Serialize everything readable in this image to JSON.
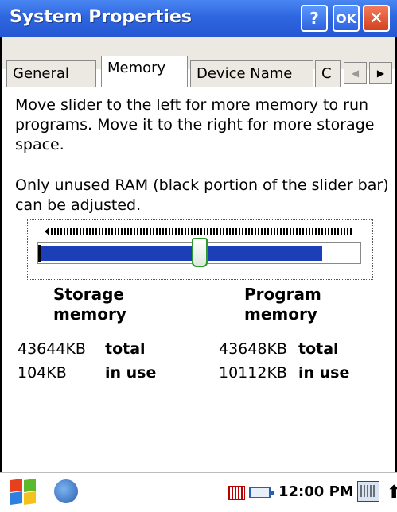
{
  "window": {
    "title": "System Properties",
    "help_label": "?",
    "ok_label": "OK",
    "close_label": "✕"
  },
  "tabs": [
    {
      "label": "General"
    },
    {
      "label": "Memory"
    },
    {
      "label": "Device Name"
    },
    {
      "label": "C"
    }
  ],
  "tab_scroll": {
    "left": "◀",
    "right": "▶"
  },
  "instructions": {
    "line1": "Move slider to the left for more memory to run programs. Move it to the right for more storage space.",
    "line2": "Only unused RAM (black portion of the slider bar) can be adjusted."
  },
  "slider": {
    "position_fraction": 0.5
  },
  "storage": {
    "heading": "Storage memory",
    "total_value": "43644KB",
    "total_label": "total",
    "inuse_value": "104KB",
    "inuse_label": "in use"
  },
  "program": {
    "heading": "Program memory",
    "total_value": "43648KB",
    "total_label": "total",
    "inuse_value": "10112KB",
    "inuse_label": "in use"
  },
  "taskbar": {
    "time": "12:00 PM",
    "colors": {
      "start_red": "#e8401c",
      "start_green": "#5cb82c",
      "start_blue": "#2f80e0",
      "start_yellow": "#f4c21c"
    }
  },
  "colors": {
    "titlebar": "#2f66e0",
    "slider_fill": "#1c3fb7",
    "thumb_border": "#2d9a2d"
  }
}
